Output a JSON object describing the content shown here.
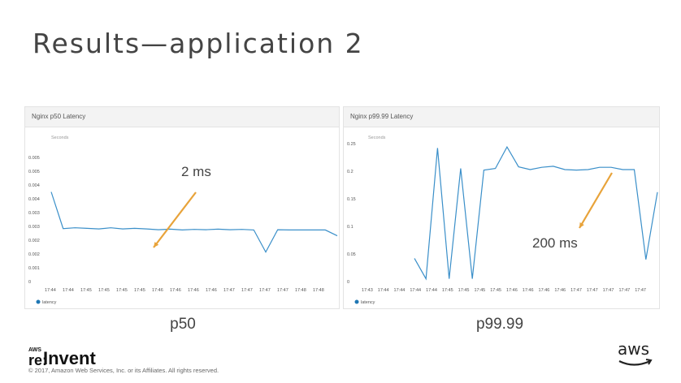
{
  "slide": {
    "title": "Results—application 2",
    "caption_left": "p50",
    "caption_right": "p99.99",
    "copyright": "© 2017, Amazon Web Services, Inc. or its Affiliates. All rights reserved.",
    "event_logo_small": "AWS",
    "event_logo_re": "re:",
    "event_logo_main": "Invent",
    "brand_logo": "aws"
  },
  "colors": {
    "line": "#3a8fc9",
    "annotation_arrow": "#e8a33a",
    "legend_dot": "#1f77b4"
  },
  "chart_data": [
    {
      "type": "line",
      "title": "Nginx p50 Latency",
      "ylabel": "Seconds",
      "ylim": [
        0,
        0.005
      ],
      "yticks": [
        "0",
        "0.001",
        "0.002",
        "0.002",
        "0.003",
        "0.003",
        "0.004",
        "0.004",
        "0.005",
        "0.005"
      ],
      "ytick_values": [
        0,
        0.0005,
        0.001,
        0.0015,
        0.002,
        0.0025,
        0.003,
        0.0035,
        0.004,
        0.0045,
        0.005
      ],
      "xticks": [
        "17:44",
        "17:44",
        "17:45",
        "17:45",
        "17:45",
        "17:45",
        "17:46",
        "17:46",
        "17:46",
        "17:46",
        "17:47",
        "17:47",
        "17:47",
        "17:47",
        "17:48",
        "17:48"
      ],
      "series": [
        {
          "name": "latency",
          "values": [
            0.00325,
            0.00192,
            0.00195,
            0.00193,
            0.00191,
            0.00195,
            0.00191,
            0.00193,
            0.00191,
            0.00188,
            0.0019,
            0.00187,
            0.00189,
            0.00188,
            0.0019,
            0.00188,
            0.00189,
            0.00187,
            0.00107,
            0.00188,
            0.00187,
            0.00187,
            0.00187,
            0.00187,
            0.00166
          ]
        }
      ],
      "annotation": {
        "text": "2 ms"
      },
      "legend": "bottom-left",
      "grid": false
    },
    {
      "type": "line",
      "title": "Nginx p99.99 Latency",
      "ylabel": "Seconds",
      "ylim": [
        0,
        0.25
      ],
      "yticks": [
        "0",
        "0.05",
        "0.1",
        "0.15",
        "0.2",
        "0.25"
      ],
      "ytick_values": [
        0,
        0.05,
        0.1,
        0.15,
        0.2,
        0.25
      ],
      "xticks": [
        "17:43",
        "17:44",
        "17:44",
        "17:44",
        "17:44",
        "17:45",
        "17:45",
        "17:45",
        "17:45",
        "17:46",
        "17:46",
        "17:46",
        "17:46",
        "17:47",
        "17:47",
        "17:47",
        "17:47",
        "17:47"
      ],
      "series": [
        {
          "name": "latency",
          "values": [
            null,
            null,
            null,
            null,
            0.042,
            0.005,
            0.242,
            0.005,
            0.205,
            0.005,
            0.202,
            0.205,
            0.244,
            0.208,
            0.203,
            0.207,
            0.209,
            0.203,
            0.202,
            0.203,
            0.207,
            0.207,
            0.203,
            0.203,
            0.04,
            0.162
          ]
        }
      ],
      "annotation": {
        "text": "200 ms"
      },
      "legend": "bottom-left",
      "grid": false
    }
  ]
}
